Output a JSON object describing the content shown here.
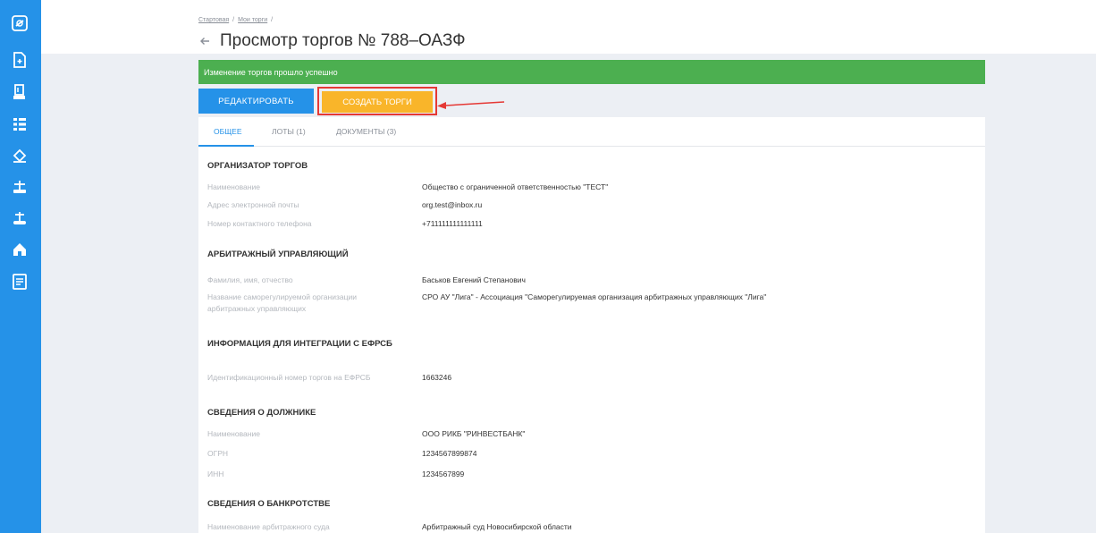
{
  "sidebar": {
    "icons": [
      "logo-icon",
      "document-icon",
      "gavel-icon",
      "list-icon",
      "auction-icon",
      "scales-icon",
      "scales-alt-icon",
      "home-icon",
      "contract-icon"
    ]
  },
  "breadcrumb": {
    "home": "Стартовая",
    "my_trades": "Мои торги",
    "separator": "/"
  },
  "page": {
    "title": "Просмотр торгов № 788–ОАЗФ"
  },
  "banner": {
    "text": "Изменение торгов прошло успешно",
    "color": "#4caf50"
  },
  "actions": {
    "edit_label": "РЕДАКТИРОВАТЬ",
    "create_label": "СОЗДАТЬ ТОРГИ"
  },
  "tabs": [
    {
      "label": "ОБЩЕЕ",
      "active": true
    },
    {
      "label": "ЛОТЫ (1)",
      "active": false
    },
    {
      "label": "ДОКУМЕНТЫ (3)",
      "active": false
    }
  ],
  "sections": {
    "organizer": {
      "title": "ОРГАНИЗАТОР ТОРГОВ",
      "name_label": "Наименование",
      "name_value": "Общество с ограниченной ответственностью \"ТЕСТ\"",
      "email_label": "Адрес электронной почты",
      "email_value": "org.test@inbox.ru",
      "phone_label": "Номер контактного телефона",
      "phone_value": "+711111111111111"
    },
    "manager": {
      "title": "АРБИТРАЖНЫЙ УПРАВЛЯЮЩИЙ",
      "fio_label": "Фамилия, имя, отчество",
      "fio_value": "Баськов Евгений Степанович",
      "sro_label": "Название саморегулируемой организации арбитражных управляющих",
      "sro_value": "СРО АУ \"Лига\" - Ассоциация \"Саморегулируемая организация арбитражных управляющих \"Лига\""
    },
    "efrsb": {
      "title": "ИНФОРМАЦИЯ ДЛЯ ИНТЕГРАЦИИ С ЕФРСБ",
      "id_label": "Идентификационный номер торгов на ЕФРСБ",
      "id_value": "1663246"
    },
    "debtor": {
      "title": "СВЕДЕНИЯ О ДОЛЖНИКЕ",
      "name_label": "Наименование",
      "name_value": "ООО РИКБ \"РИНВЕСТБАНК\"",
      "ogrn_label": "ОГРН",
      "ogrn_value": "1234567899874",
      "inn_label": "ИНН",
      "inn_value": "1234567899"
    },
    "bankruptcy": {
      "title": "СВЕДЕНИЯ О БАНКРОТСТВЕ",
      "court_label": "Наименование арбитражного суда",
      "court_value": "Арбитражный суд Новосибирской области"
    }
  }
}
